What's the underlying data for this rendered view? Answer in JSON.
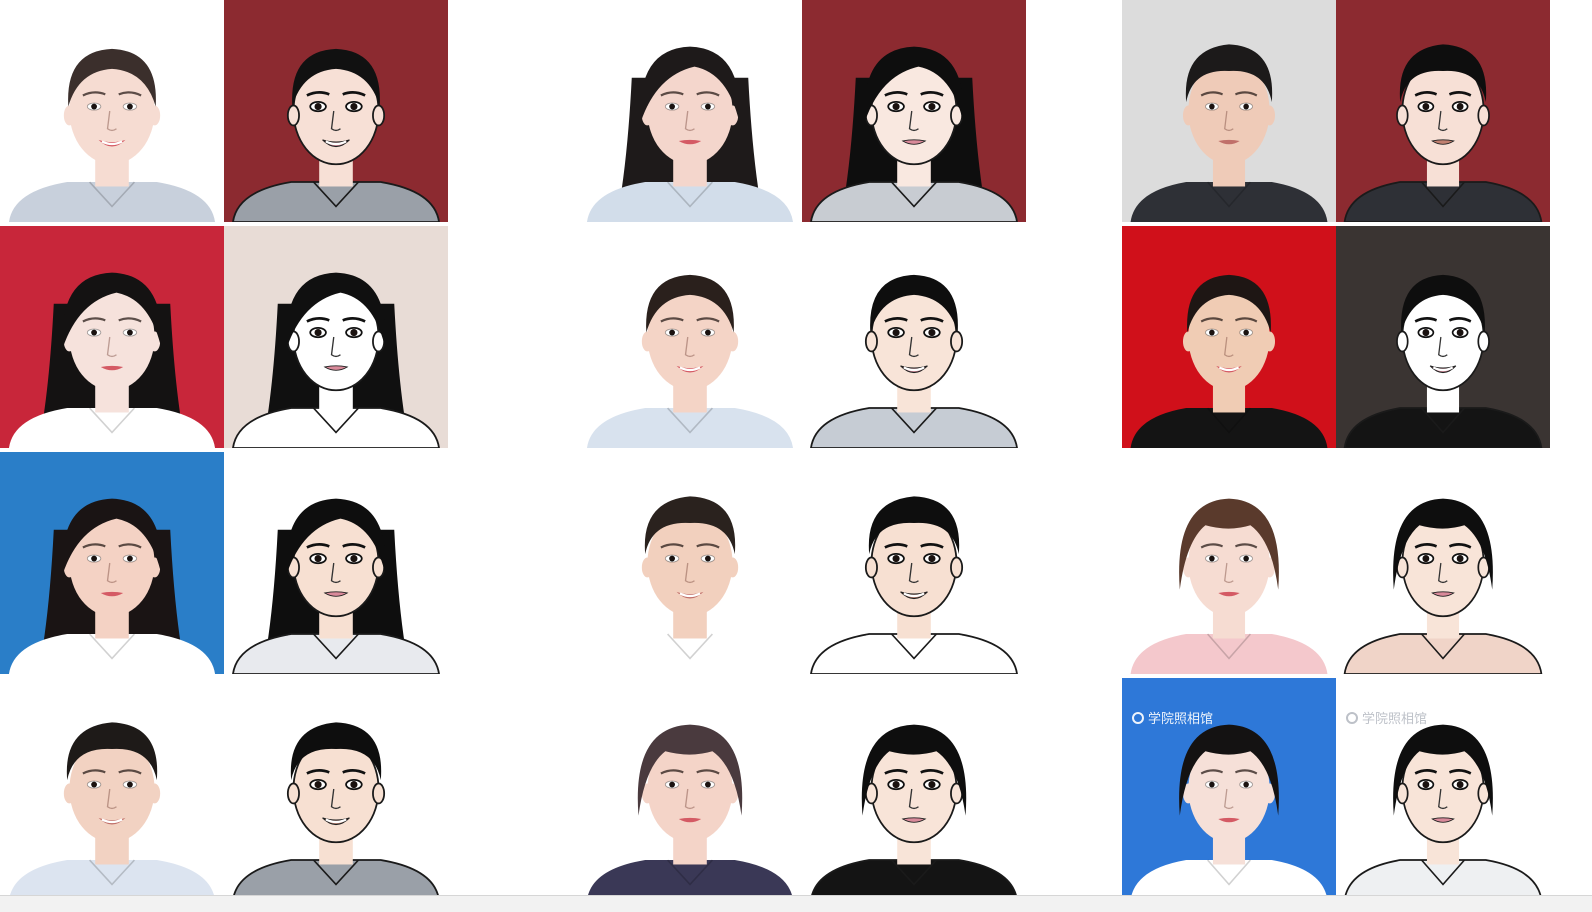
{
  "collage": {
    "description_free": true,
    "tiles": [
      {
        "id": "r1-g1-photo",
        "bg": "#ffffff",
        "kind": "photo",
        "skin": "#f6dcd2",
        "hair": "#3b2f2c",
        "hair_style": "bun",
        "shirt": "#c8d0dc",
        "gender": "f",
        "smile": true
      },
      {
        "id": "r1-g1-cartoon",
        "bg": "#8c2a30",
        "kind": "cartoon",
        "skin": "#f7e0d6",
        "hair": "#111111",
        "hair_style": "bun",
        "shirt": "#9aa0a8",
        "gender": "f",
        "smile": true
      },
      {
        "id": "r1-g2-photo",
        "bg": "#ffffff",
        "kind": "photo",
        "skin": "#f4d6cc",
        "hair": "#1e1a1a",
        "hair_style": "long",
        "shirt": "#d2ddea",
        "gender": "f",
        "smile": false
      },
      {
        "id": "r1-g2-cartoon",
        "bg": "#8c2a30",
        "kind": "cartoon",
        "skin": "#f9e8e0",
        "hair": "#0e0e0e",
        "hair_style": "long",
        "shirt": "#c8ccd2",
        "gender": "f",
        "smile": false
      },
      {
        "id": "r1-g3-photo",
        "bg": "#dcdcdc",
        "kind": "photo",
        "skin": "#efcbb8",
        "hair": "#1c1a1a",
        "hair_style": "short",
        "shirt": "#2e3036",
        "gender": "m",
        "smile": false
      },
      {
        "id": "r1-g3-cartoon",
        "bg": "#8c2a30",
        "kind": "cartoon",
        "skin": "#f7e0d6",
        "hair": "#0e0e0e",
        "hair_style": "short",
        "shirt": "#2e3036",
        "gender": "m",
        "smile": false
      },
      {
        "id": "r2-g1-photo",
        "bg": "#c8263a",
        "kind": "photo",
        "skin": "#f6e2dc",
        "hair": "#141212",
        "hair_style": "long",
        "shirt": "#ffffff",
        "gender": "f",
        "smile": false
      },
      {
        "id": "r2-g1-cartoon",
        "bg": "#e8dcd6",
        "kind": "cartoon",
        "skin": "#ffffff",
        "hair": "#101010",
        "hair_style": "long",
        "shirt": "#ffffff",
        "gender": "f",
        "smile": false
      },
      {
        "id": "r2-g2-photo",
        "bg": "#ffffff",
        "kind": "photo",
        "skin": "#f4d4c6",
        "hair": "#2a201c",
        "hair_style": "bun",
        "shirt": "#d8e2ee",
        "gender": "f",
        "smile": true
      },
      {
        "id": "r2-g2-cartoon",
        "bg": "#ffffff",
        "kind": "cartoon",
        "skin": "#f8e4d8",
        "hair": "#0e0e0e",
        "hair_style": "bun",
        "shirt": "#c6ccd4",
        "gender": "f",
        "smile": true
      },
      {
        "id": "r2-g3-photo",
        "bg": "#d0101a",
        "kind": "photo",
        "skin": "#f0ccb4",
        "hair": "#1e1614",
        "hair_style": "bun",
        "shirt": "#141414",
        "gender": "f",
        "smile": true
      },
      {
        "id": "r2-g3-cartoon",
        "bg": "#3a3432",
        "kind": "cartoon",
        "skin": "#ffffff",
        "hair": "#0e0e0e",
        "hair_style": "bun",
        "shirt": "#141414",
        "gender": "f",
        "smile": true
      },
      {
        "id": "r3-g1-photo",
        "bg": "#2a7ec8",
        "kind": "photo",
        "skin": "#f4d2c4",
        "hair": "#1a1414",
        "hair_style": "long",
        "shirt": "#ffffff",
        "gender": "f",
        "smile": false
      },
      {
        "id": "r3-g1-cartoon",
        "bg": "#ffffff",
        "kind": "cartoon",
        "skin": "#f7e0d2",
        "hair": "#0e0e0e",
        "hair_style": "long",
        "shirt": "#e8eaee",
        "gender": "f",
        "smile": false
      },
      {
        "id": "r3-g2-photo",
        "bg": "#ffffff",
        "kind": "photo",
        "skin": "#f2d0be",
        "hair": "#2a221e",
        "hair_style": "short",
        "shirt": "#ffffff",
        "gender": "m",
        "smile": true
      },
      {
        "id": "r3-g2-cartoon",
        "bg": "#ffffff",
        "kind": "cartoon",
        "skin": "#f7e0d2",
        "hair": "#0e0e0e",
        "hair_style": "short",
        "shirt": "#ffffff",
        "gender": "m",
        "smile": true
      },
      {
        "id": "r3-g3-photo",
        "bg": "#ffffff",
        "kind": "photo",
        "skin": "#f6dcd2",
        "hair": "#5a3a2c",
        "hair_style": "bob",
        "shirt": "#f4c8cc",
        "gender": "f",
        "smile": false
      },
      {
        "id": "r3-g3-cartoon",
        "bg": "#ffffff",
        "kind": "cartoon",
        "skin": "#f8e4d8",
        "hair": "#0e0e0e",
        "hair_style": "bob",
        "shirt": "#f0d4c8",
        "gender": "f",
        "smile": false
      },
      {
        "id": "r4-g1-photo",
        "bg": "#ffffff",
        "kind": "photo",
        "skin": "#f2d2c2",
        "hair": "#1e1a18",
        "hair_style": "short",
        "shirt": "#dce4f0",
        "gender": "m",
        "smile": true
      },
      {
        "id": "r4-g1-cartoon",
        "bg": "#ffffff",
        "kind": "cartoon",
        "skin": "#f7e0d2",
        "hair": "#0e0e0e",
        "hair_style": "short",
        "shirt": "#9aa0a8",
        "gender": "m",
        "smile": true
      },
      {
        "id": "r4-g2-photo",
        "bg": "#ffffff",
        "kind": "photo",
        "skin": "#f4d4c8",
        "hair": "#4a3a3e",
        "hair_style": "bob",
        "shirt": "#3a3856",
        "gender": "f",
        "smile": false
      },
      {
        "id": "r4-g2-cartoon",
        "bg": "#ffffff",
        "kind": "cartoon",
        "skin": "#f8e4d8",
        "hair": "#0e0e0e",
        "hair_style": "bob",
        "shirt": "#141414",
        "gender": "f",
        "smile": false
      },
      {
        "id": "r4-g3-photo",
        "bg": "#2e78d8",
        "kind": "photo",
        "skin": "#f6e0d8",
        "hair": "#141212",
        "hair_style": "bob",
        "shirt": "#ffffff",
        "gender": "f",
        "smile": false
      },
      {
        "id": "r4-g3-cartoon",
        "bg": "#ffffff",
        "kind": "cartoon",
        "skin": "#f8e4d8",
        "hair": "#0e0e0e",
        "hair_style": "bob",
        "shirt": "#eef0f2",
        "gender": "f",
        "smile": false
      }
    ]
  },
  "watermarks": {
    "photo_text": "学院照相馆",
    "cartoon_text": "学院照相馆"
  }
}
